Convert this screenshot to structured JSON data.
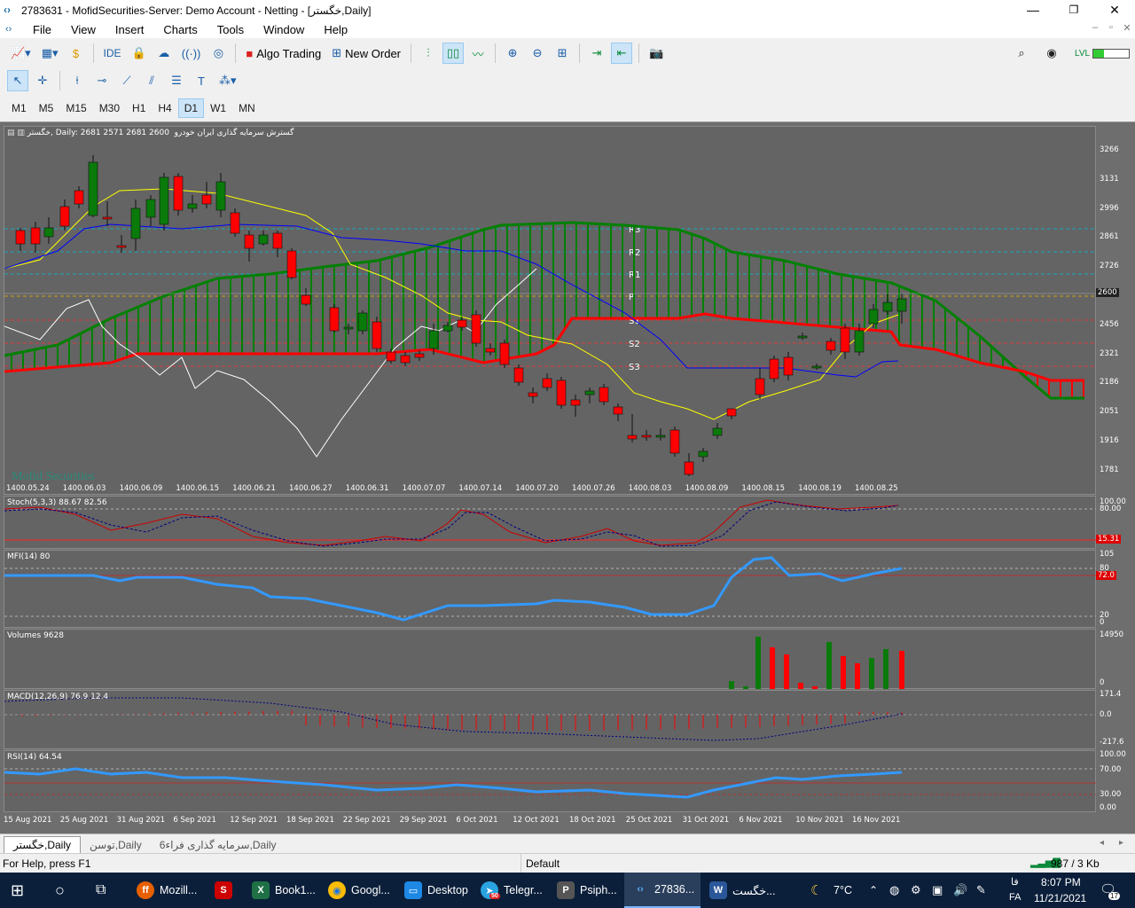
{
  "window": {
    "title": "2783631 - MofidSecurities-Server: Demo Account - Netting - [خگستر,Daily]",
    "minimize": "—",
    "maximize": "❐",
    "close": "✕"
  },
  "menu": [
    "File",
    "View",
    "Insert",
    "Charts",
    "Tools",
    "Window",
    "Help"
  ],
  "toolbar": {
    "ide_label": "IDE",
    "algo_trading_label": "Algo Trading",
    "new_order_label": "New Order"
  },
  "timeframes": [
    "M1",
    "M5",
    "M15",
    "M30",
    "H1",
    "H4",
    "D1",
    "W1",
    "MN"
  ],
  "active_timeframe": "D1",
  "main_chart": {
    "header": "خگستر, Daily:  2681 2571 2681 2600",
    "symbol_description": "گسترش سرمایه گذاری ایران خودرو",
    "watermark": "Mofid Securities",
    "pivot_labels": [
      "R3",
      "R2",
      "R1",
      "P",
      "S1",
      "S2",
      "S3"
    ],
    "price_ticks": [
      "3266",
      "3131",
      "2996",
      "2861",
      "2726",
      "2591",
      "2456",
      "2321",
      "2186",
      "2051",
      "1916",
      "1781"
    ],
    "current_price": "2600",
    "date_ticks": [
      "1400.05.24",
      "1400.06.03",
      "1400.06.09",
      "1400.06.15",
      "1400.06.21",
      "1400.06.27",
      "1400.06.31",
      "1400.07.07",
      "1400.07.14",
      "1400.07.20",
      "1400.07.26",
      "1400.08.03",
      "1400.08.09",
      "1400.08.15",
      "1400.08.19",
      "1400.08.25"
    ]
  },
  "indicators": {
    "stoch": {
      "label": "Stoch(5,3,3) 88.67 82.56",
      "ticks": [
        "100.00",
        "80.00"
      ],
      "marker": "15.31"
    },
    "mfi": {
      "label": "MFI(14) 80",
      "ticks": [
        "105",
        "80",
        "20",
        "0"
      ],
      "marker": "72.0"
    },
    "volumes": {
      "label": "Volumes 9628",
      "ticks": [
        "14950",
        "0"
      ]
    },
    "macd": {
      "label": "MACD(12,26,9) 76.9 12.4",
      "ticks": [
        "171.4",
        "0.0",
        "-217.6"
      ]
    },
    "rsi": {
      "label": "RSI(14) 64.54",
      "ticks": [
        "100.00",
        "70.00",
        "30.00",
        "0.00"
      ]
    }
  },
  "x_axis_dates": [
    "15 Aug 2021",
    "25 Aug 2021",
    "31 Aug 2021",
    "6 Sep 2021",
    "12 Sep 2021",
    "18 Sep 2021",
    "22 Sep 2021",
    "29 Sep 2021",
    "6 Oct 2021",
    "12 Oct 2021",
    "18 Oct 2021",
    "25 Oct 2021",
    "31 Oct 2021",
    "6 Nov 2021",
    "10 Nov 2021",
    "16 Nov 2021"
  ],
  "chart_tabs": [
    "خگستر,Daily",
    "توسن,Daily",
    "سرمایه گذاری فراء6,Daily"
  ],
  "statusbar": {
    "help": "For Help, press F1",
    "profile": "Default",
    "connection": "987 / 3 Kb"
  },
  "taskbar": {
    "apps": [
      "Mozill...",
      "",
      "Book1...",
      "Googl...",
      "Desktop",
      "Telegr...",
      "Psiph...",
      "27836...",
      "خگست..."
    ],
    "telegram_badge": "50",
    "weather": "7°C",
    "lang_top": "فا",
    "lang_bottom": "FA",
    "time": "8:07 PM",
    "date": "11/21/2021",
    "notifications": "17"
  },
  "colors": {
    "bull_candle": "#0a7a0a",
    "bear_candle": "#ff0000",
    "chart_bg": "#646464",
    "kumo_bull": "#008000",
    "kumo_bear": "#ff0000",
    "tenkan": "#ffff00",
    "kijun": "#0000ff",
    "chikou": "#ffffff",
    "oscillator_line": "#3399ff"
  }
}
